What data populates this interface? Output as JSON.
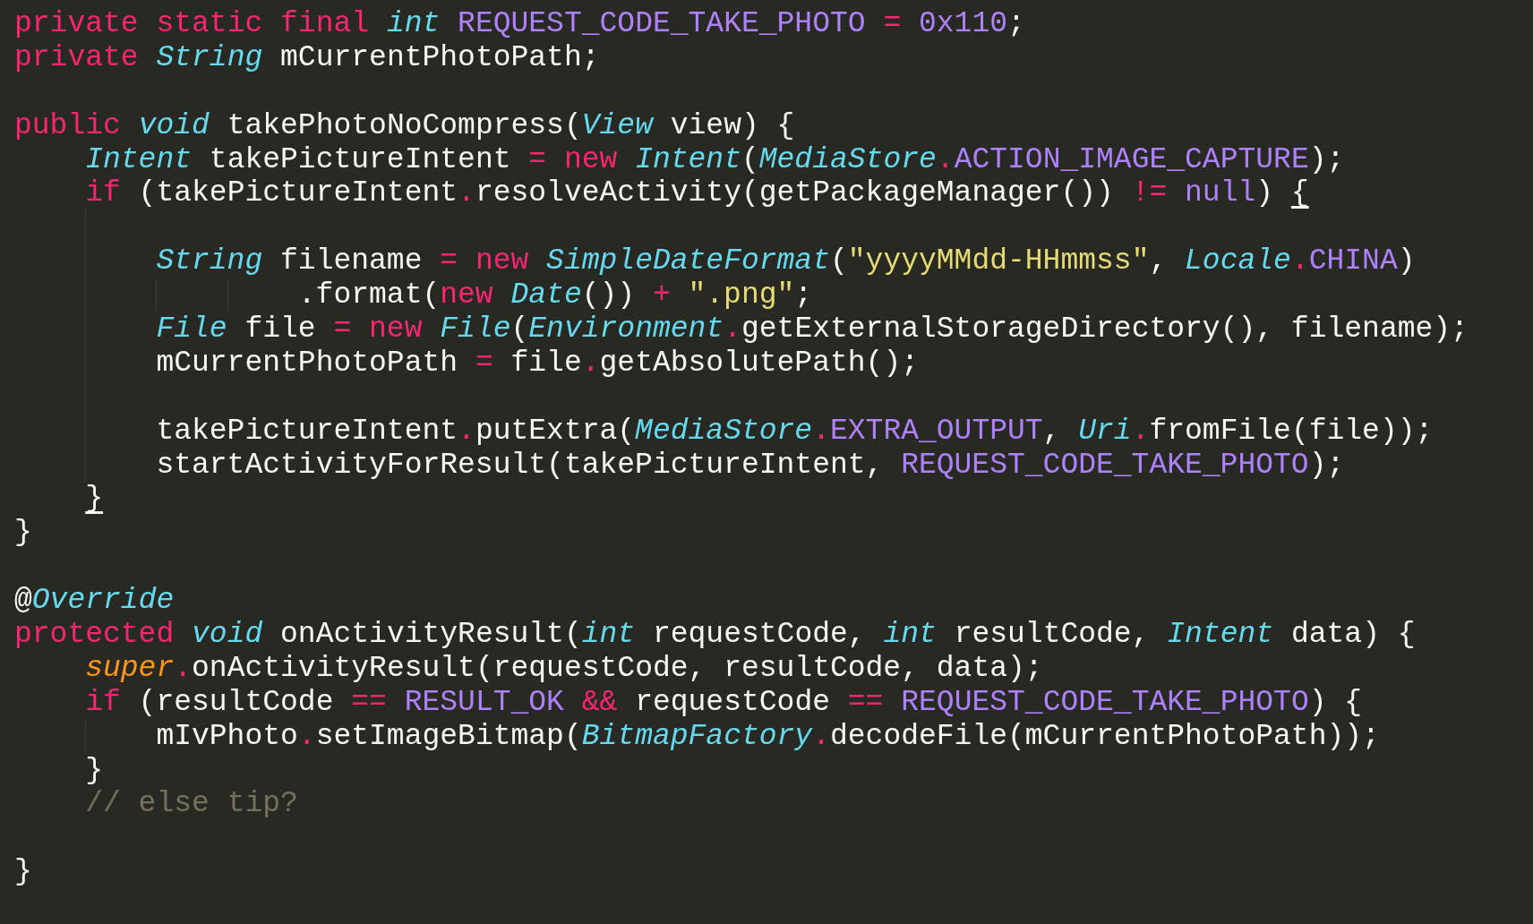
{
  "editor": {
    "lines": [
      {
        "kind": "code",
        "tokens": [
          {
            "text": "private static final ",
            "kind": "keyword"
          },
          {
            "text": "int ",
            "kind": "type"
          },
          {
            "text": "REQUEST_CODE_TAKE_PHOTO ",
            "kind": "constant"
          },
          {
            "text": "= ",
            "kind": "keyword"
          },
          {
            "text": "0x110",
            "kind": "constant"
          },
          {
            "text": ";",
            "kind": "plain"
          }
        ]
      },
      {
        "kind": "code",
        "tokens": [
          {
            "text": "private ",
            "kind": "keyword"
          },
          {
            "text": "String",
            "kind": "type"
          },
          {
            "text": " mCurrentPhotoPath;",
            "kind": "plain"
          }
        ]
      },
      {
        "kind": "blank"
      },
      {
        "kind": "code",
        "tokens": [
          {
            "text": "public ",
            "kind": "keyword"
          },
          {
            "text": "void",
            "kind": "type"
          },
          {
            "text": " takePhotoNoCompress(",
            "kind": "plain"
          },
          {
            "text": "View",
            "kind": "type"
          },
          {
            "text": " view) {",
            "kind": "plain"
          }
        ],
        "children": [
          {
            "kind": "code",
            "tokens": [
              {
                "text": "Intent",
                "kind": "type"
              },
              {
                "text": " takePictureIntent ",
                "kind": "plain"
              },
              {
                "text": "= new ",
                "kind": "keyword"
              },
              {
                "text": "Intent",
                "kind": "type"
              },
              {
                "text": "(",
                "kind": "plain"
              },
              {
                "text": "MediaStore",
                "kind": "type"
              },
              {
                "text": ".",
                "kind": "keyword"
              },
              {
                "text": "ACTION_IMAGE_CAPTURE",
                "kind": "constant"
              },
              {
                "text": ");",
                "kind": "plain"
              }
            ]
          },
          {
            "kind": "code",
            "tokens": [
              {
                "text": "if",
                "kind": "keyword"
              },
              {
                "text": " (takePictureIntent",
                "kind": "plain"
              },
              {
                "text": ".",
                "kind": "keyword"
              },
              {
                "text": "resolveActivity(getPackageManager()) ",
                "kind": "plain"
              },
              {
                "text": "!= ",
                "kind": "keyword"
              },
              {
                "text": "null",
                "kind": "constant"
              },
              {
                "text": ") ",
                "kind": "plain"
              },
              {
                "text": "{",
                "kind": "bracket"
              }
            ],
            "children": [
              {
                "kind": "blank"
              },
              {
                "kind": "code",
                "tokens": [
                  {
                    "text": "String",
                    "kind": "type"
                  },
                  {
                    "text": " filename ",
                    "kind": "plain"
                  },
                  {
                    "text": "= new ",
                    "kind": "keyword"
                  },
                  {
                    "text": "SimpleDateFormat",
                    "kind": "type"
                  },
                  {
                    "text": "(",
                    "kind": "plain"
                  },
                  {
                    "text": "\"yyyyMMdd-HHmmss\"",
                    "kind": "string"
                  },
                  {
                    "text": ", ",
                    "kind": "plain"
                  },
                  {
                    "text": "Locale",
                    "kind": "type"
                  },
                  {
                    "text": ".",
                    "kind": "keyword"
                  },
                  {
                    "text": "CHINA",
                    "kind": "constant"
                  },
                  {
                    "text": ")",
                    "kind": "plain"
                  }
                ],
                "children": [
                  {
                    "kind": "continuation",
                    "tokens": [
                      {
                        "text": ".format(",
                        "kind": "plain"
                      },
                      {
                        "text": "new ",
                        "kind": "keyword"
                      },
                      {
                        "text": "Date",
                        "kind": "type"
                      },
                      {
                        "text": "()) ",
                        "kind": "plain"
                      },
                      {
                        "text": "+ ",
                        "kind": "keyword"
                      },
                      {
                        "text": "\".png\"",
                        "kind": "string"
                      },
                      {
                        "text": ";",
                        "kind": "plain"
                      }
                    ]
                  }
                ]
              },
              {
                "kind": "code",
                "tokens": [
                  {
                    "text": "File",
                    "kind": "type"
                  },
                  {
                    "text": " file ",
                    "kind": "plain"
                  },
                  {
                    "text": "= new ",
                    "kind": "keyword"
                  },
                  {
                    "text": "File",
                    "kind": "type"
                  },
                  {
                    "text": "(",
                    "kind": "plain"
                  },
                  {
                    "text": "Environment",
                    "kind": "type"
                  },
                  {
                    "text": ".",
                    "kind": "keyword"
                  },
                  {
                    "text": "getExternalStorageDirectory(), filename);",
                    "kind": "plain"
                  }
                ]
              },
              {
                "kind": "code",
                "tokens": [
                  {
                    "text": "mCurrentPhotoPath ",
                    "kind": "plain"
                  },
                  {
                    "text": "=",
                    "kind": "keyword"
                  },
                  {
                    "text": " file",
                    "kind": "plain"
                  },
                  {
                    "text": ".",
                    "kind": "keyword"
                  },
                  {
                    "text": "getAbsolutePath();",
                    "kind": "plain"
                  }
                ]
              },
              {
                "kind": "blank"
              },
              {
                "kind": "code",
                "tokens": [
                  {
                    "text": "takePictureIntent",
                    "kind": "plain"
                  },
                  {
                    "text": ".",
                    "kind": "keyword"
                  },
                  {
                    "text": "putExtra(",
                    "kind": "plain"
                  },
                  {
                    "text": "MediaStore",
                    "kind": "type"
                  },
                  {
                    "text": ".",
                    "kind": "keyword"
                  },
                  {
                    "text": "EXTRA_OUTPUT",
                    "kind": "constant"
                  },
                  {
                    "text": ", ",
                    "kind": "plain"
                  },
                  {
                    "text": "Uri",
                    "kind": "type"
                  },
                  {
                    "text": ".",
                    "kind": "keyword"
                  },
                  {
                    "text": "fromFile(file));",
                    "kind": "plain"
                  }
                ]
              },
              {
                "kind": "code",
                "tokens": [
                  {
                    "text": "startActivityForResult(takePictureIntent, ",
                    "kind": "plain"
                  },
                  {
                    "text": "REQUEST_CODE_TAKE_PHOTO",
                    "kind": "constant"
                  },
                  {
                    "text": ");",
                    "kind": "plain"
                  }
                ]
              }
            ]
          },
          {
            "kind": "code",
            "tokens": [
              {
                "text": "}",
                "kind": "bracket"
              }
            ]
          }
        ]
      },
      {
        "kind": "code",
        "tokens": [
          {
            "text": "}",
            "kind": "plain"
          }
        ]
      },
      {
        "kind": "blank"
      },
      {
        "kind": "code",
        "tokens": [
          {
            "text": "@",
            "kind": "plain"
          },
          {
            "text": "Override",
            "kind": "type"
          }
        ]
      },
      {
        "kind": "code",
        "tokens": [
          {
            "text": "protected ",
            "kind": "keyword"
          },
          {
            "text": "void",
            "kind": "type"
          },
          {
            "text": " onActivityResult(",
            "kind": "plain"
          },
          {
            "text": "int",
            "kind": "type"
          },
          {
            "text": " requestCode, ",
            "kind": "plain"
          },
          {
            "text": "int",
            "kind": "type"
          },
          {
            "text": " resultCode, ",
            "kind": "plain"
          },
          {
            "text": "Intent",
            "kind": "type"
          },
          {
            "text": " data) {",
            "kind": "plain"
          }
        ],
        "children": [
          {
            "kind": "code",
            "tokens": [
              {
                "text": "super",
                "kind": "builtin"
              },
              {
                "text": ".",
                "kind": "keyword"
              },
              {
                "text": "onActivityResult(requestCode, resultCode, data);",
                "kind": "plain"
              }
            ]
          },
          {
            "kind": "code",
            "tokens": [
              {
                "text": "if",
                "kind": "keyword"
              },
              {
                "text": " (resultCode ",
                "kind": "plain"
              },
              {
                "text": "== ",
                "kind": "keyword"
              },
              {
                "text": "RESULT_OK ",
                "kind": "constant"
              },
              {
                "text": "&&",
                "kind": "keyword"
              },
              {
                "text": " requestCode ",
                "kind": "plain"
              },
              {
                "text": "== ",
                "kind": "keyword"
              },
              {
                "text": "REQUEST_CODE_TAKE_PHOTO",
                "kind": "constant"
              },
              {
                "text": ") {",
                "kind": "plain"
              }
            ],
            "children": [
              {
                "kind": "code",
                "tokens": [
                  {
                    "text": "mIvPhoto",
                    "kind": "plain"
                  },
                  {
                    "text": ".",
                    "kind": "keyword"
                  },
                  {
                    "text": "setImageBitmap(",
                    "kind": "plain"
                  },
                  {
                    "text": "BitmapFactory",
                    "kind": "type"
                  },
                  {
                    "text": ".",
                    "kind": "keyword"
                  },
                  {
                    "text": "decodeFile(mCurrentPhotoPath));",
                    "kind": "plain"
                  }
                ]
              }
            ]
          },
          {
            "kind": "code",
            "tokens": [
              {
                "text": "}",
                "kind": "plain"
              }
            ]
          },
          {
            "kind": "code",
            "tokens": [
              {
                "text": "// else tip?",
                "kind": "comment"
              }
            ]
          },
          {
            "kind": "blank"
          }
        ]
      },
      {
        "kind": "code",
        "tokens": [
          {
            "text": "}",
            "kind": "plain"
          }
        ]
      }
    ]
  }
}
